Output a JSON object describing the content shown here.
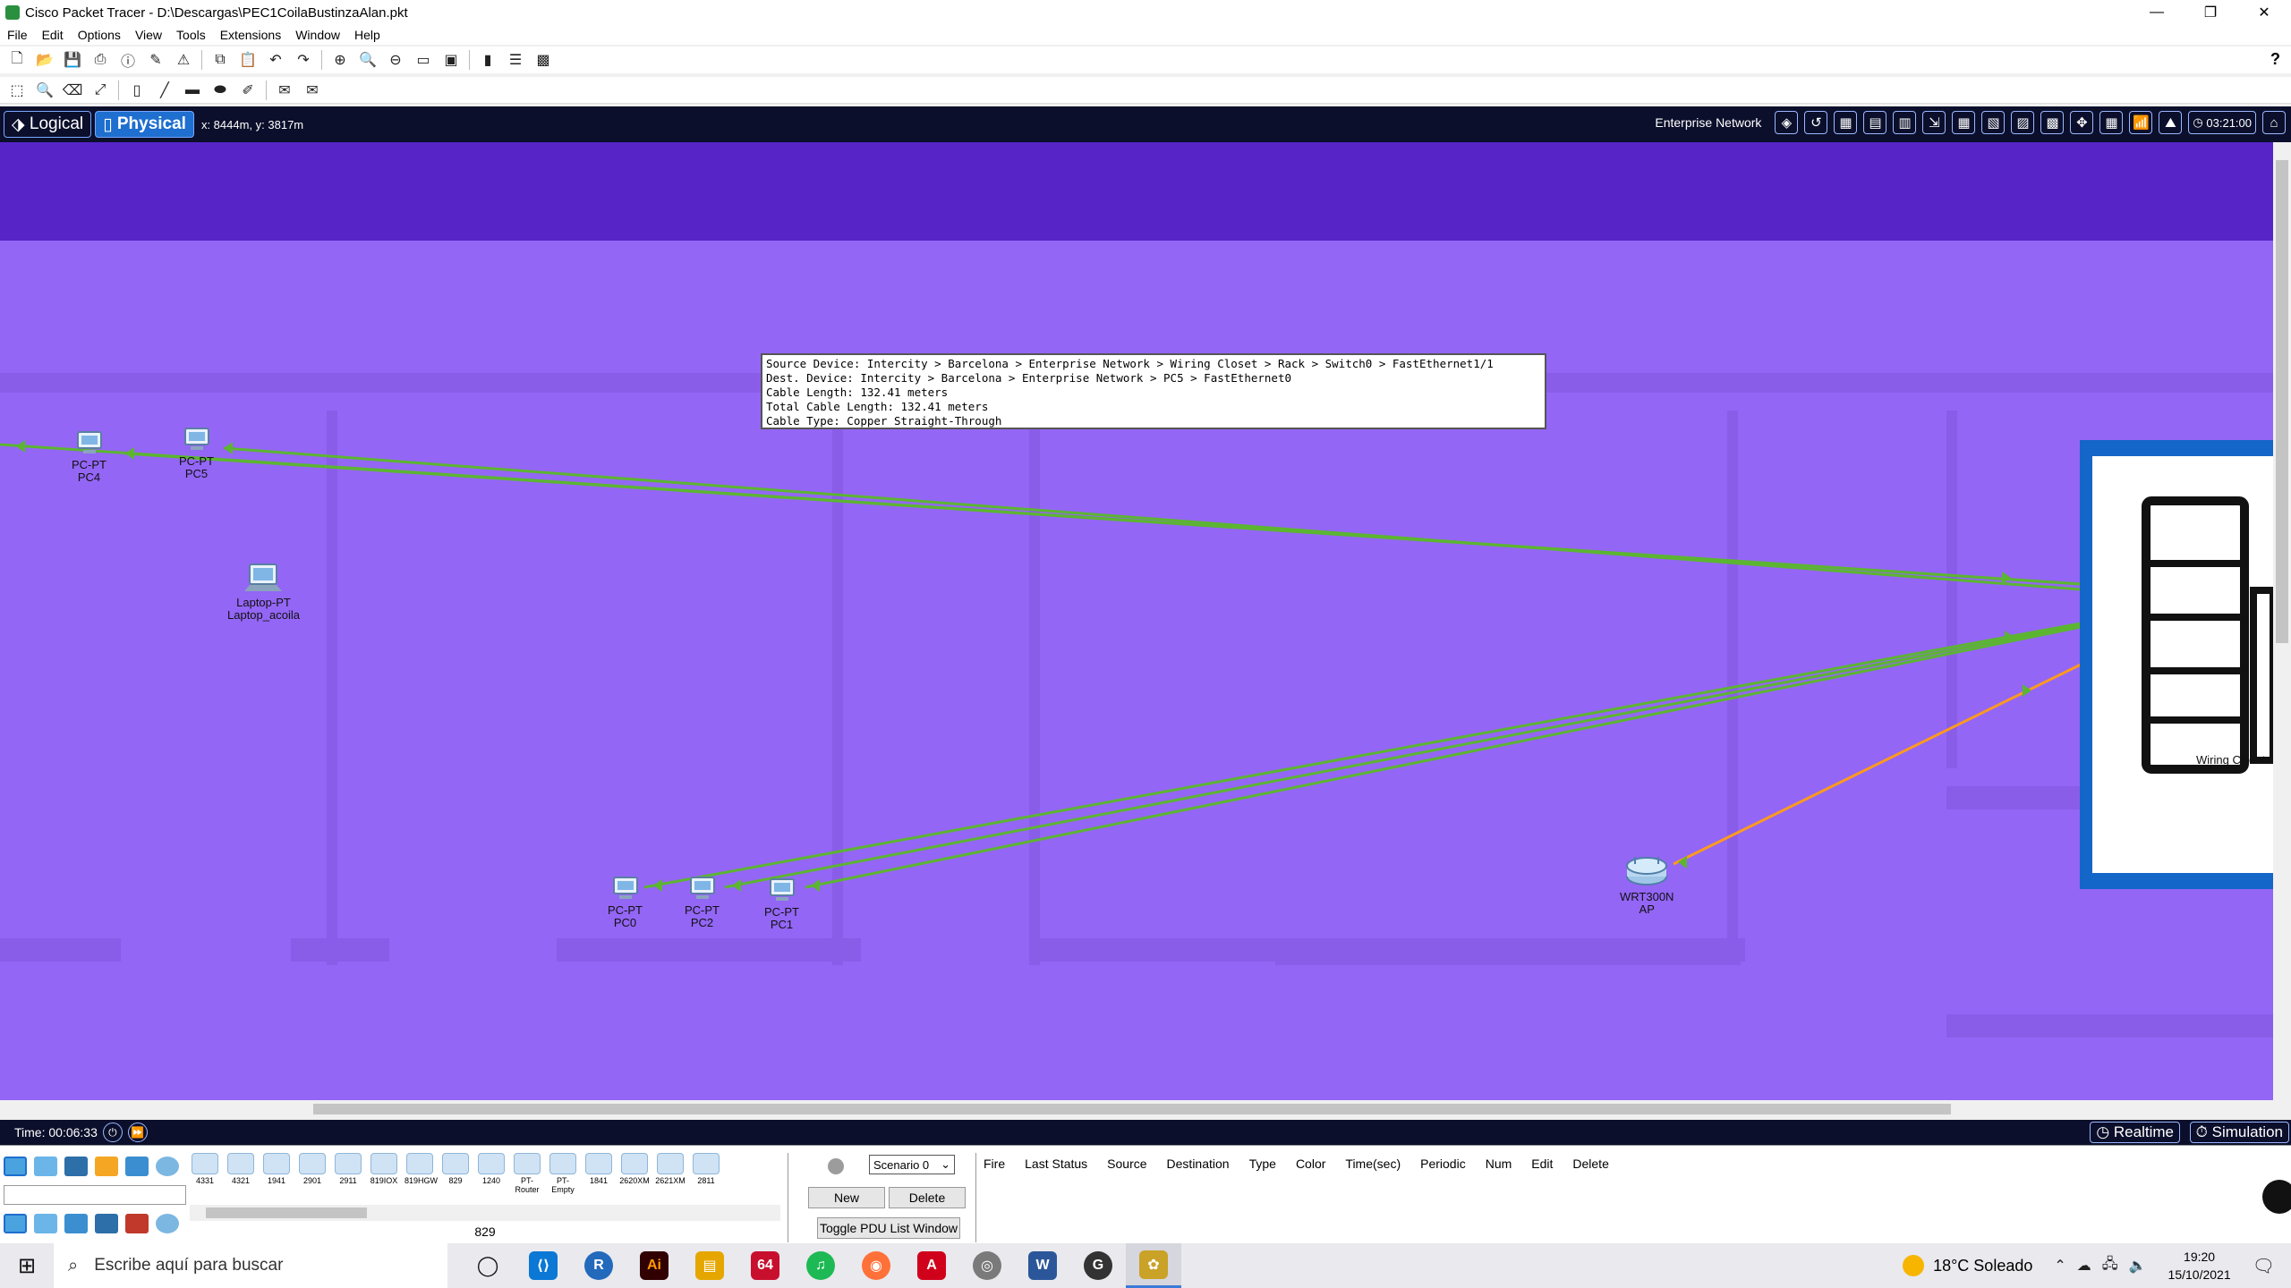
{
  "window": {
    "title": "Cisco Packet Tracer - D:\\Descargas\\PEC1CoilaBustinzaAlan.pkt",
    "controls": [
      "—",
      "❐",
      "✕"
    ]
  },
  "menu": [
    "File",
    "Edit",
    "Options",
    "View",
    "Tools",
    "Extensions",
    "Window",
    "Help"
  ],
  "nav": {
    "logical_label": "Logical",
    "physical_label": "Physical",
    "coords": "x: 8444m, y: 3817m",
    "location_label": "Enterprise Network",
    "clock": "03:21:00"
  },
  "devices": {
    "pc4": {
      "model": "PC-PT",
      "name": "PC4"
    },
    "pc5": {
      "model": "PC-PT",
      "name": "PC5"
    },
    "laptop": {
      "model": "Laptop-PT",
      "name": "Laptop_acoila"
    },
    "pc0": {
      "model": "PC-PT",
      "name": "PC0"
    },
    "pc2": {
      "model": "PC-PT",
      "name": "PC2"
    },
    "pc1": {
      "model": "PC-PT",
      "name": "PC1"
    },
    "ap": {
      "model": "WRT300N",
      "name": "AP"
    },
    "closet": {
      "name": "Wiring Closet"
    }
  },
  "tooltip": {
    "line1": "Source Device: Intercity > Barcelona > Enterprise Network > Wiring Closet > Rack > Switch0 > FastEthernet1/1",
    "line2": "Dest. Device: Intercity > Barcelona > Enterprise Network > PC5 > FastEthernet0",
    "line3": "Cable Length: 132.41 meters",
    "line4": "Total Cable Length: 132.41 meters",
    "line5": "Cable Type: Copper Straight-Through"
  },
  "timebar": {
    "time": "Time: 00:06:33",
    "realtime_label": "Realtime",
    "simulation_label": "Simulation"
  },
  "models": [
    "4331",
    "4321",
    "1941",
    "2901",
    "2911",
    "819IOX",
    "819HGW",
    "829",
    "1240",
    "PT-Router",
    "PT-Empty",
    "1841",
    "2620XM",
    "2621XM",
    "2811"
  ],
  "model_caption": "829",
  "scenario": {
    "selected": "Scenario 0",
    "new_label": "New",
    "delete_label": "Delete",
    "toggle_label": "Toggle PDU List Window"
  },
  "pdu_columns": [
    "Fire",
    "Last Status",
    "Source",
    "Destination",
    "Type",
    "Color",
    "Time(sec)",
    "Periodic",
    "Num",
    "Edit",
    "Delete"
  ],
  "taskbar": {
    "search_placeholder": "Escribe aquí para buscar",
    "weather": "18°C  Soleado",
    "time": "19:20",
    "date": "15/10/2021",
    "apps": [
      {
        "label": "◯",
        "color": "#e9e9ee"
      },
      {
        "label": "⟨⟩",
        "color": "#0a78d4"
      },
      {
        "label": "R",
        "color": "#2369bc"
      },
      {
        "label": "Ai",
        "color": "#310000"
      },
      {
        "label": "▤",
        "color": "#e6a600"
      },
      {
        "label": "64",
        "color": "#c8102e"
      },
      {
        "label": "♫",
        "color": "#1db954"
      },
      {
        "label": "◉",
        "color": "#ff7139"
      },
      {
        "label": "A",
        "color": "#d0021b"
      },
      {
        "label": "◎",
        "color": "#7a7a7a"
      },
      {
        "label": "W",
        "color": "#2b579a"
      },
      {
        "label": "G",
        "color": "#333333"
      },
      {
        "label": "✿",
        "color": "#c9a227"
      }
    ]
  },
  "colors": {
    "workspace": "#9366f5",
    "band": "#5724c8",
    "cable_green": "#5cb531",
    "cable_orange": "#ff9a1e",
    "closet_blue": "#1466c8",
    "nav_dark": "#0b0f2b"
  }
}
